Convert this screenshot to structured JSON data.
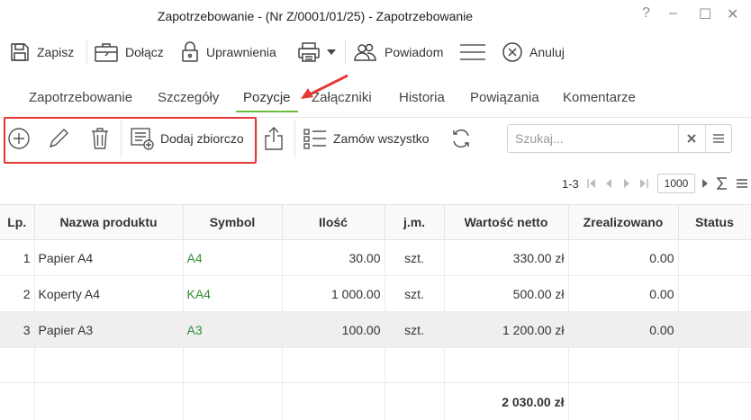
{
  "window": {
    "title": "Zapotrzebowanie - (Nr Z/0001/01/25) - Zapotrzebowanie",
    "help": "?",
    "minimize": "–",
    "maximize": "☐",
    "close": "✕"
  },
  "toolbar": {
    "save": "Zapisz",
    "attach": "Dołącz",
    "permissions": "Uprawnienia",
    "notify": "Powiadom",
    "cancel": "Anuluj"
  },
  "tabs": [
    {
      "label": "Zapotrzebowanie"
    },
    {
      "label": "Szczegóły"
    },
    {
      "label": "Pozycje",
      "active": true
    },
    {
      "label": "Załączniki"
    },
    {
      "label": "Historia"
    },
    {
      "label": "Powiązania"
    },
    {
      "label": "Komentarze"
    }
  ],
  "actions": {
    "bulk_add": "Dodaj zbiorczo",
    "order_all": "Zamów wszystko"
  },
  "search": {
    "placeholder": "Szukaj..."
  },
  "pager": {
    "range": "1-3",
    "page_size": "1000"
  },
  "table": {
    "columns": [
      "Lp.",
      "Nazwa produktu",
      "Symbol",
      "Ilość",
      "j.m.",
      "Wartość netto",
      "Zrealizowano",
      "Status"
    ],
    "rows": [
      {
        "lp": "1",
        "name": "Papier A4",
        "symbol": "A4",
        "qty": "30.00",
        "unit": "szt.",
        "value": "330.00 zł",
        "done": "0.00",
        "status": ""
      },
      {
        "lp": "2",
        "name": "Koperty A4",
        "symbol": "KA4",
        "qty": "1 000.00",
        "unit": "szt.",
        "value": "500.00 zł",
        "done": "0.00",
        "status": ""
      },
      {
        "lp": "3",
        "name": "Papier A3",
        "symbol": "A3",
        "qty": "100.00",
        "unit": "szt.",
        "value": "1 200.00 zł",
        "done": "0.00",
        "status": ""
      }
    ],
    "total": "2 030.00 zł"
  },
  "colors": {
    "accent": "#6bbd3e",
    "highlight": "#e53935",
    "symbol": "#2e8b2e"
  }
}
